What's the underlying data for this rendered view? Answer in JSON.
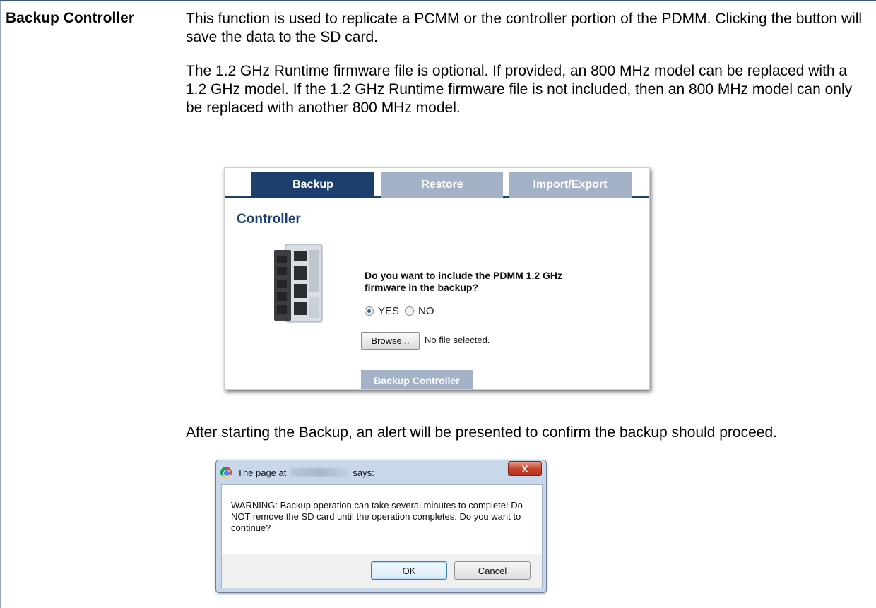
{
  "term": "Backup Controller",
  "paragraphs": [
    "This function is used to replicate a PCMM or the controller portion of the PDMM. Clicking the button will save the data to the SD card.",
    "The 1.2 GHz Runtime firmware file is optional. If provided, an 800 MHz model can be replaced with a 1.2 GHz model. If the 1.2 GHz Runtime firmware file is not included, then an 800 MHz model can only be replaced with another 800 MHz model.",
    "After starting the Backup, an alert will be presented to confirm the backup should proceed."
  ],
  "screenshot": {
    "tabs": [
      "Backup",
      "Restore",
      "Import/Export"
    ],
    "active_tab": "Backup",
    "title": "Controller",
    "question": "Do you want to include the PDMM 1.2 GHz firmware in the backup?",
    "radio_yes": "YES",
    "radio_no": "NO",
    "radio_selected": "YES",
    "browse_label": "Browse...",
    "file_status": "No file selected.",
    "backup_button": "Backup Controller",
    "colors": {
      "primary": "#1c3f6e",
      "inactive": "#a3b2c7"
    }
  },
  "dialog": {
    "title_prefix": "The page at",
    "title_suffix": "says:",
    "close_label": "X",
    "message": "WARNING: Backup operation can take several minutes to complete! Do NOT remove the SD card until the operation completes. Do you want to continue?",
    "ok_label": "OK",
    "cancel_label": "Cancel"
  }
}
